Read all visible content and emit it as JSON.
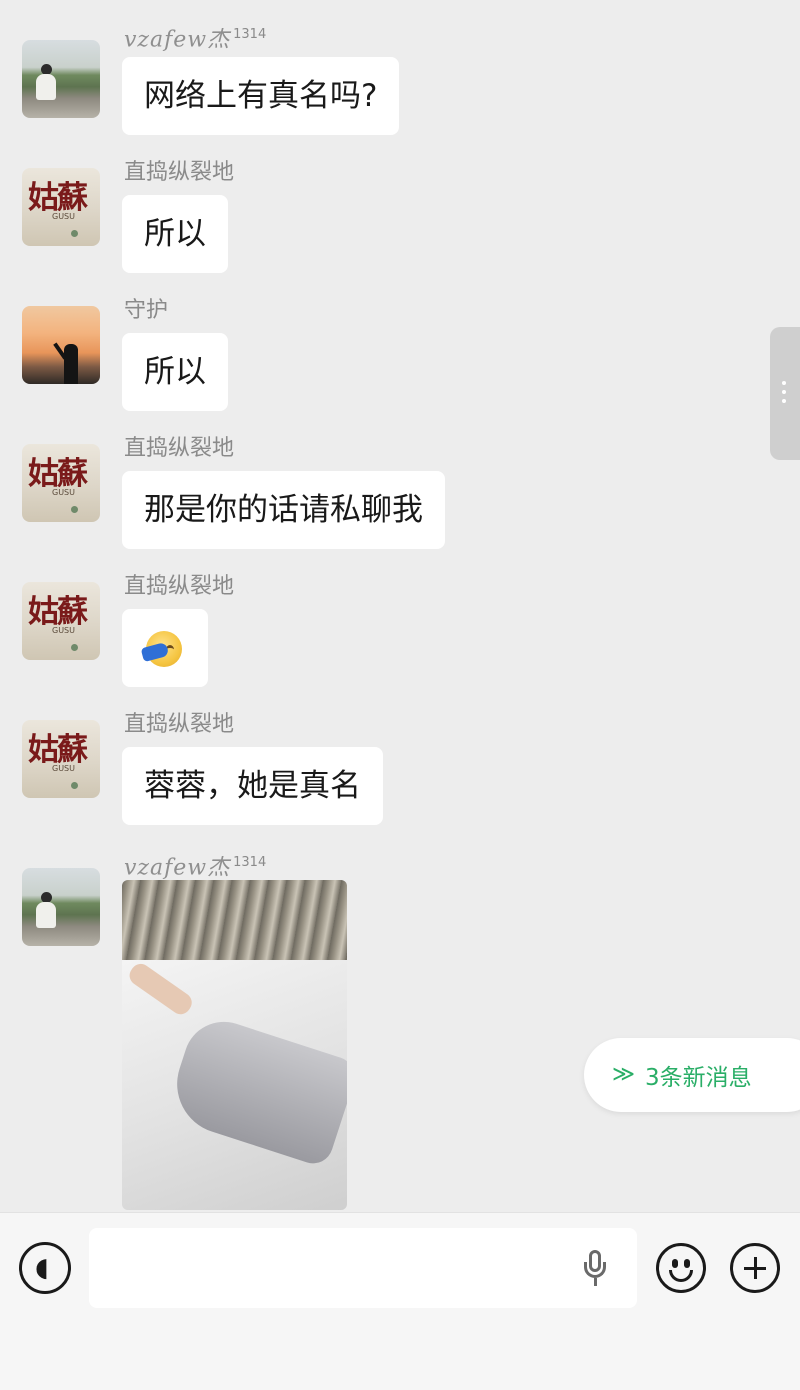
{
  "messages": [
    {
      "sender": "vzafew杰",
      "sender_suffix": "1314",
      "avatar": "landscape-avatar",
      "text": "网络上有真名吗?"
    },
    {
      "sender": "直捣纵裂地",
      "avatar": "book-cover-avatar",
      "avatar_title": "姑蘇",
      "avatar_subtitle": "GUSU",
      "text": "所以"
    },
    {
      "sender": "守护",
      "avatar": "sunset-avatar",
      "text": "所以"
    },
    {
      "sender": "直捣纵裂地",
      "avatar": "book-cover-avatar",
      "avatar_title": "姑蘇",
      "avatar_subtitle": "GUSU",
      "text": "那是你的话请私聊我"
    },
    {
      "sender": "直捣纵裂地",
      "avatar": "book-cover-avatar",
      "avatar_title": "姑蘇",
      "avatar_subtitle": "GUSU",
      "emoji": "facepalm-laugh-emoji"
    },
    {
      "sender": "直捣纵裂地",
      "avatar": "book-cover-avatar",
      "avatar_title": "姑蘇",
      "avatar_subtitle": "GUSU",
      "text": "蓉蓉，她是真名"
    },
    {
      "sender": "vzafew杰",
      "sender_suffix": "1314",
      "avatar": "landscape-avatar",
      "image": "photo-message"
    }
  ],
  "new_messages_pill": {
    "label": "3条新消息",
    "icon": "double-chevron-down-icon",
    "color": "#2aae67"
  },
  "input_bar": {
    "voice_icon": "voice-toggle-icon",
    "mic_icon": "microphone-icon",
    "emoji_icon": "emoji-icon",
    "plus_icon": "plus-icon",
    "text_value": ""
  },
  "colors": {
    "background": "#ededed",
    "bubble": "#ffffff",
    "sender_name": "#8a8a8a",
    "accent_green": "#2aae67"
  }
}
